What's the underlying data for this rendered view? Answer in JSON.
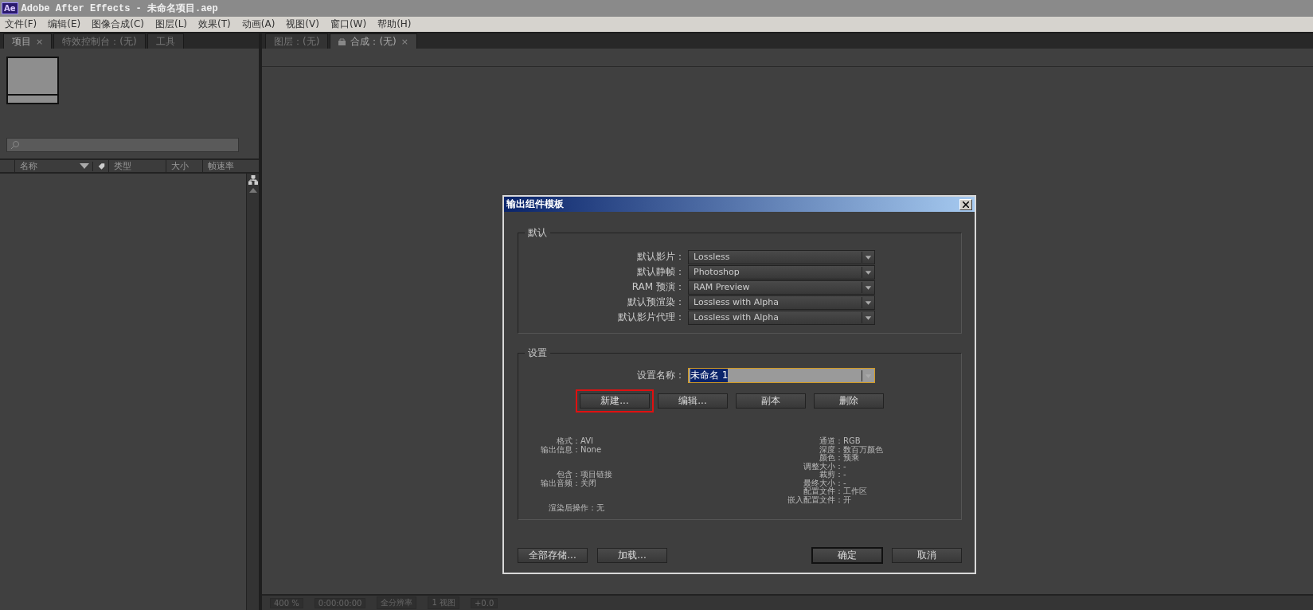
{
  "window": {
    "title": "Adobe After Effects - 未命名项目.aep",
    "app_badge": "Ae"
  },
  "menu": [
    "文件(F)",
    "编辑(E)",
    "图像合成(C)",
    "图层(L)",
    "效果(T)",
    "动画(A)",
    "视图(V)",
    "窗口(W)",
    "帮助(H)"
  ],
  "left_tabs": [
    {
      "label": "项目",
      "selected": true,
      "close": "×"
    },
    {
      "label": "特效控制台：(无)",
      "selected": false
    },
    {
      "label": "工具",
      "selected": false
    }
  ],
  "right_tabs": [
    {
      "label": "图层：(无)",
      "selected": false,
      "kind": "plain"
    },
    {
      "label": "合成：(无)",
      "selected": true,
      "kind": "locked",
      "close": "×"
    }
  ],
  "project": {
    "columns": [
      {
        "label": "名称",
        "kind": "sort"
      },
      {
        "kind": "tag"
      },
      {
        "label": "类型",
        "kind": "text"
      },
      {
        "label": "大小",
        "kind": "text"
      },
      {
        "label": "帧速率",
        "kind": "text"
      }
    ]
  },
  "viewer_toolbar": [
    "400 %",
    "0:00:00:00",
    "全分辨率",
    "1 视图",
    "+0.0"
  ],
  "dialog": {
    "title": "输出组件模板",
    "defaults": {
      "legend": "默认",
      "rows": [
        {
          "label": "默认影片：",
          "value": "Lossless"
        },
        {
          "label": "默认静帧：",
          "value": "Photoshop"
        },
        {
          "label": "RAM 预演：",
          "value": "RAM Preview"
        },
        {
          "label": "默认预渲染：",
          "value": "Lossless with Alpha"
        },
        {
          "label": "默认影片代理：",
          "value": "Lossless with Alpha"
        }
      ]
    },
    "settings": {
      "legend": "设置",
      "name_label": "设置名称：",
      "name_value": "未命名 1",
      "buttons": [
        {
          "label": "新建...",
          "highlighted": true
        },
        {
          "label": "编辑...",
          "highlighted": false
        },
        {
          "label": "副本",
          "highlighted": false
        },
        {
          "label": "删除",
          "highlighted": false
        }
      ],
      "info_left": [
        [
          {
            "label": "格式：",
            "value": "AVI"
          },
          {
            "label": "输出信息：",
            "value": "None"
          }
        ],
        [
          {
            "label": "包含：",
            "value": "项目链接"
          },
          {
            "label": "输出音频：",
            "value": "关闭"
          }
        ],
        [
          {
            "label": "渲染后操作：",
            "value": "无"
          }
        ]
      ],
      "info_right": [
        {
          "label": "通道：",
          "value": "RGB"
        },
        {
          "label": "深度：",
          "value": "数百万颜色"
        },
        {
          "label": "颜色：",
          "value": "预乘"
        },
        {
          "label": "调整大小：",
          "value": "-"
        },
        {
          "label": "裁剪：",
          "value": "-"
        },
        {
          "label": "最终大小：",
          "value": "-"
        },
        {
          "label": "配置文件：",
          "value": "工作区"
        },
        {
          "label": "嵌入配置文件：",
          "value": "开"
        }
      ]
    },
    "footer_left": [
      "全部存储...",
      "加载..."
    ],
    "footer_right": [
      {
        "label": "确定",
        "default": true
      },
      {
        "label": "取消",
        "default": false
      }
    ]
  }
}
